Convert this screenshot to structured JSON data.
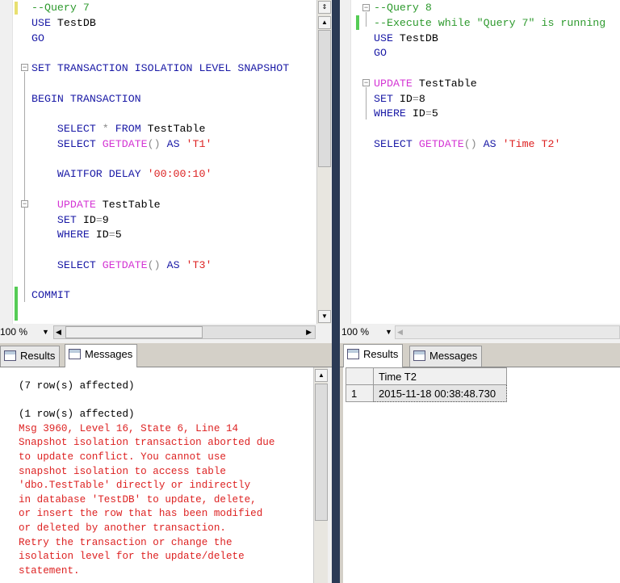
{
  "left_editor": {
    "lines": [
      [
        [
          "--Query 7",
          "cm"
        ]
      ],
      [
        [
          "USE",
          "kw"
        ],
        [
          " TestDB",
          ""
        ]
      ],
      [
        [
          "GO",
          "kw"
        ]
      ],
      [],
      [
        [
          "SET TRANSACTION ISOLATION LEVEL SNAPSHOT",
          "kw"
        ]
      ],
      [],
      [
        [
          "BEGIN TRANSACTION",
          "kw"
        ]
      ],
      [],
      [
        [
          "    SELECT",
          "kw"
        ],
        [
          " * ",
          "op"
        ],
        [
          "FROM",
          "kw"
        ],
        [
          " TestTable",
          ""
        ]
      ],
      [
        [
          "    SELECT ",
          "kw"
        ],
        [
          "GETDATE",
          "fn"
        ],
        [
          "() ",
          "op"
        ],
        [
          "AS ",
          "kw"
        ],
        [
          "'T1'",
          "str"
        ]
      ],
      [],
      [
        [
          "    WAITFOR DELAY ",
          "kw"
        ],
        [
          "'00:00:10'",
          "str"
        ]
      ],
      [],
      [
        [
          "    UPDATE",
          "fn"
        ],
        [
          " TestTable",
          ""
        ]
      ],
      [
        [
          "    SET",
          "kw"
        ],
        [
          " ID",
          ""
        ],
        [
          "=",
          "op"
        ],
        [
          "9",
          ""
        ]
      ],
      [
        [
          "    WHERE",
          "kw"
        ],
        [
          " ID",
          ""
        ],
        [
          "=",
          "op"
        ],
        [
          "5",
          ""
        ]
      ],
      [],
      [
        [
          "    SELECT ",
          "kw"
        ],
        [
          "GETDATE",
          "fn"
        ],
        [
          "() ",
          "op"
        ],
        [
          "AS ",
          "kw"
        ],
        [
          "'T3'",
          "str"
        ]
      ],
      [],
      [
        [
          "COMMIT",
          "kw"
        ]
      ]
    ]
  },
  "right_editor": {
    "lines": [
      [
        [
          "--Query 8",
          "cm"
        ]
      ],
      [
        [
          "--Execute while \"Query 7\" is running",
          "cm"
        ]
      ],
      [
        [
          "USE",
          "kw"
        ],
        [
          " TestDB",
          ""
        ]
      ],
      [
        [
          "GO",
          "kw"
        ]
      ],
      [],
      [
        [
          "UPDATE",
          "fn"
        ],
        [
          " TestTable",
          ""
        ]
      ],
      [
        [
          "SET",
          "kw"
        ],
        [
          " ID",
          ""
        ],
        [
          "=",
          "op"
        ],
        [
          "8",
          ""
        ]
      ],
      [
        [
          "WHERE",
          "kw"
        ],
        [
          " ID",
          ""
        ],
        [
          "=",
          "op"
        ],
        [
          "5",
          ""
        ]
      ],
      [],
      [
        [
          "SELECT ",
          "kw"
        ],
        [
          "GETDATE",
          "fn"
        ],
        [
          "() ",
          "op"
        ],
        [
          "AS ",
          "kw"
        ],
        [
          "'Time T2'",
          "str"
        ]
      ]
    ]
  },
  "left_zoom": "100 %",
  "right_zoom": "100 %",
  "tabs": {
    "results": "Results",
    "messages": "Messages"
  },
  "messages": [
    {
      "text": "(7 row(s) affected)",
      "type": "info"
    },
    {
      "text": "",
      "type": "info"
    },
    {
      "text": "(1 row(s) affected)",
      "type": "info"
    },
    {
      "text": "Msg 3960, Level 16, State 6, Line 14",
      "type": "err"
    },
    {
      "text": "Snapshot isolation transaction aborted due",
      "type": "err"
    },
    {
      "text": "to update conflict. You cannot use",
      "type": "err"
    },
    {
      "text": "snapshot isolation to access table",
      "type": "err"
    },
    {
      "text": "'dbo.TestTable' directly or indirectly",
      "type": "err"
    },
    {
      "text": "in database 'TestDB' to update, delete,",
      "type": "err"
    },
    {
      "text": "or insert the row that has been modified",
      "type": "err"
    },
    {
      "text": "or deleted by another transaction.",
      "type": "err"
    },
    {
      "text": "Retry the transaction or change the",
      "type": "err"
    },
    {
      "text": "isolation level for the update/delete",
      "type": "err"
    },
    {
      "text": "statement.",
      "type": "err"
    }
  ],
  "results_grid": {
    "columns": [
      "Time T2"
    ],
    "rows": [
      {
        "num": "1",
        "cells": [
          "2015-11-18 00:38:48.730"
        ]
      }
    ]
  }
}
